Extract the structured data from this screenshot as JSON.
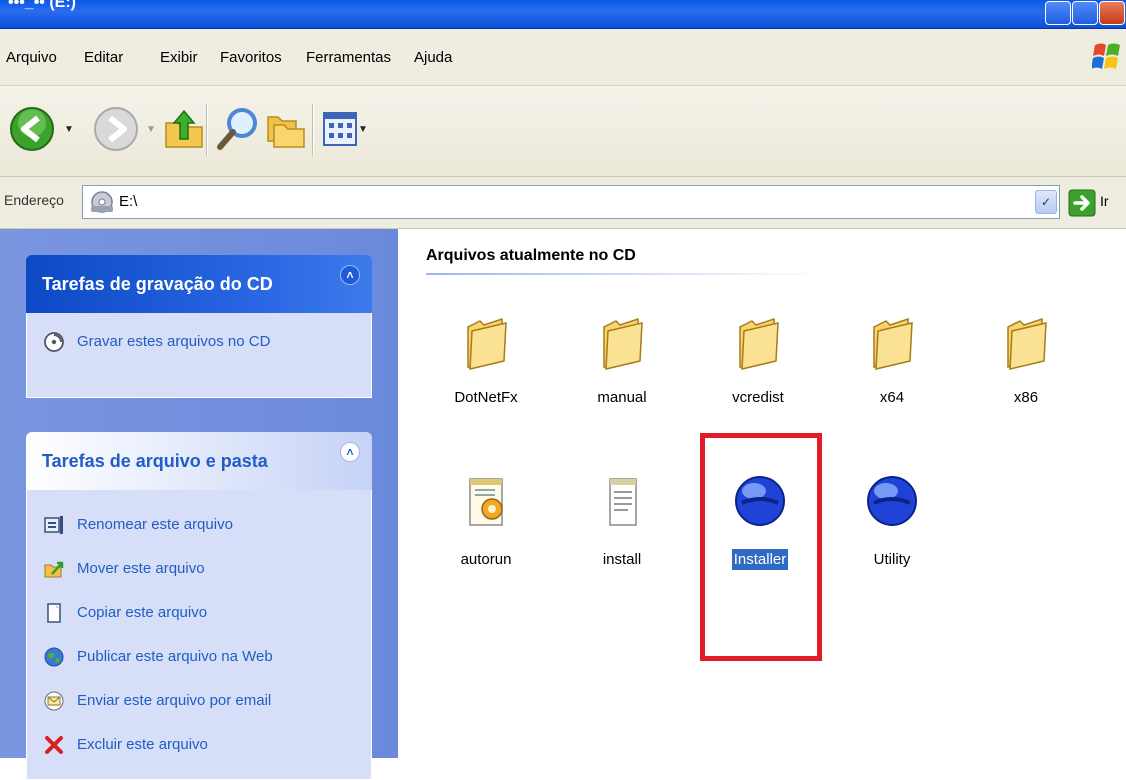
{
  "window": {
    "title": "•••_•• (E:)"
  },
  "menu": [
    "Arquivo",
    "Editar",
    "Exibir",
    "Favoritos",
    "Ferramentas",
    "Ajuda"
  ],
  "toolbar": {
    "buttons": [
      "back-icon",
      "forward-icon",
      "up-folder-icon",
      "search-icon",
      "folders-icon",
      "views-icon"
    ]
  },
  "address": {
    "label": "Endereço",
    "value": "E:\\",
    "go_label": "Ir"
  },
  "taskpane": {
    "cd_panel": {
      "title": "Tarefas de gravação do CD",
      "tasks": [
        {
          "label": "Gravar estes arquivos no CD",
          "icon": "burn-cd-icon"
        }
      ]
    },
    "file_panel": {
      "title": "Tarefas de arquivo e pasta",
      "tasks": [
        {
          "label": "Renomear este arquivo",
          "icon": "rename-icon"
        },
        {
          "label": "Mover este arquivo",
          "icon": "move-icon"
        },
        {
          "label": "Copiar este arquivo",
          "icon": "copy-icon"
        },
        {
          "label": "Publicar este arquivo na Web",
          "icon": "publish-web-icon"
        },
        {
          "label": "Enviar este arquivo por email",
          "icon": "email-icon"
        },
        {
          "label": "Excluir este arquivo",
          "icon": "delete-icon"
        }
      ]
    }
  },
  "content": {
    "group_title": "Arquivos atualmente no CD",
    "items": [
      {
        "name": "DotNetFx",
        "type": "folder"
      },
      {
        "name": "manual",
        "type": "folder"
      },
      {
        "name": "vcredist",
        "type": "folder"
      },
      {
        "name": "x64",
        "type": "folder"
      },
      {
        "name": "x86",
        "type": "folder"
      },
      {
        "name": "autorun",
        "type": "setup-info"
      },
      {
        "name": "install",
        "type": "text"
      },
      {
        "name": "Installer",
        "type": "application",
        "selected": true
      },
      {
        "name": "Utility",
        "type": "application"
      }
    ]
  },
  "colors": {
    "highlight": "#e21b2a",
    "selection": "#316ac5",
    "task_link": "#215dc6"
  }
}
